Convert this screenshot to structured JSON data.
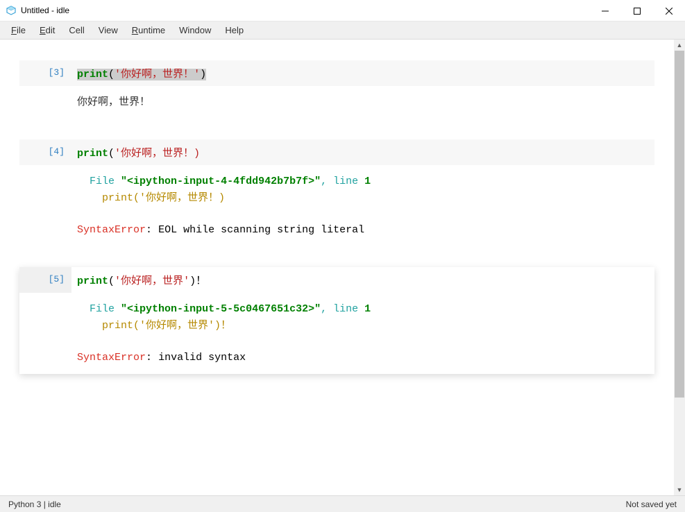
{
  "window": {
    "title": "Untitled - idle"
  },
  "menubar": {
    "items": [
      {
        "label": "File",
        "accel": "F"
      },
      {
        "label": "Edit",
        "accel": "E"
      },
      {
        "label": "Cell",
        "accel": ""
      },
      {
        "label": "View",
        "accel": ""
      },
      {
        "label": "Runtime",
        "accel": "R"
      },
      {
        "label": "Window",
        "accel": ""
      },
      {
        "label": "Help",
        "accel": ""
      }
    ]
  },
  "cells": [
    {
      "index": 3,
      "prompt": "[3]",
      "code": {
        "func": "print",
        "paren_open": "(",
        "string_open": "'",
        "string_body": "你好啊，世界！",
        "string_close": "'",
        "paren_close": ")",
        "full": "print('你好啊，世界！')"
      },
      "output_plain": "你好啊，世界！"
    },
    {
      "index": 4,
      "prompt": "[4]",
      "code": {
        "func": "print",
        "paren_open": "(",
        "string_open": "'",
        "string_body": "你好啊，世界！)",
        "full": "print('你好啊，世界！)"
      },
      "traceback": {
        "file_label": "File",
        "file_str": "\"<ipython-input-4-4fdd942b7b7f>\"",
        "line_label": "line",
        "line_no": "1",
        "echo": "print('你好啊，世界！)",
        "error_name": "SyntaxError",
        "error_msg": "EOL while scanning string literal"
      }
    },
    {
      "index": 5,
      "prompt": "[5]",
      "active": true,
      "code": {
        "func": "print",
        "paren_open": "(",
        "string_open": "'",
        "string_body": "你好啊，世界",
        "string_close": "'",
        "paren_close": ")",
        "trailing": "！",
        "full": "print('你好啊，世界')！"
      },
      "traceback": {
        "file_label": "File",
        "file_str": "\"<ipython-input-5-5c0467651c32>\"",
        "line_label": "line",
        "line_no": "1",
        "echo": "print('你好啊，世界')！",
        "error_name": "SyntaxError",
        "error_msg": "invalid syntax"
      }
    }
  ],
  "statusbar": {
    "left": "Python 3 | idle",
    "right": "Not saved yet"
  }
}
